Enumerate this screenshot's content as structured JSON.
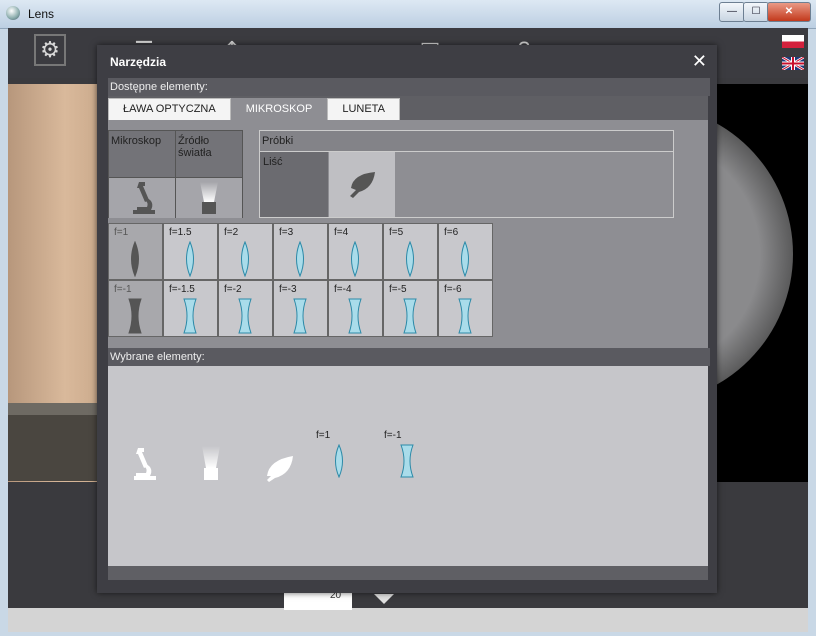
{
  "window": {
    "title": "Lens",
    "minimize": "—",
    "maximize": "☐",
    "close": "✕"
  },
  "toolbar": {
    "icons": [
      "gear-icon",
      "bench-icon",
      "ray-icon",
      "camera-icon",
      "display-icon",
      "help-icon"
    ]
  },
  "flags": [
    "flag-polish-icon",
    "flag-english-icon"
  ],
  "slider": {
    "value": "20"
  },
  "dialog": {
    "title": "Narzędzia",
    "available_label": "Dostępne elementy:",
    "tabs": [
      {
        "label": "ŁAWA OPTYCZNA",
        "active": false
      },
      {
        "label": "MIKROSKOP",
        "active": true
      },
      {
        "label": "LUNETA",
        "active": false
      }
    ],
    "categories": [
      {
        "label": "Mikroskop",
        "icon": "microscope-icon"
      },
      {
        "label": "Źródło światła",
        "icon": "light-source-icon"
      }
    ],
    "samples": {
      "header": "Próbki",
      "items": [
        {
          "label": "Liść",
          "icon": "leaf-icon"
        }
      ]
    },
    "lenses_positive": [
      "f=1",
      "f=1.5",
      "f=2",
      "f=3",
      "f=4",
      "f=5",
      "f=6"
    ],
    "lenses_negative": [
      "f=-1",
      "f=-1.5",
      "f=-2",
      "f=-3",
      "f=-4",
      "f=-5",
      "f=-6"
    ],
    "selected_label": "Wybrane elementy:",
    "selected_items": [
      {
        "icon": "microscope-icon",
        "label": ""
      },
      {
        "icon": "light-source-icon",
        "label": ""
      },
      {
        "icon": "leaf-icon",
        "label": ""
      },
      {
        "icon": "convex-lens-icon",
        "label": "f=1"
      },
      {
        "icon": "concave-lens-icon",
        "label": "f=-1"
      }
    ]
  }
}
